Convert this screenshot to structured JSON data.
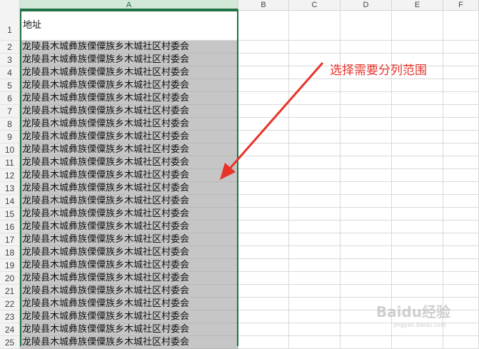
{
  "columns": [
    "A",
    "B",
    "C",
    "D",
    "E",
    "F"
  ],
  "rows": [
    "1",
    "2",
    "3",
    "4",
    "5",
    "6",
    "7",
    "8",
    "9",
    "10",
    "11",
    "12",
    "13",
    "14",
    "15",
    "16",
    "17",
    "18",
    "19",
    "20",
    "21",
    "22",
    "23",
    "24",
    "25"
  ],
  "header_cell": "地址",
  "address_value": "龙陵县木城彝族傈僳族乡木城社区村委会",
  "annotation_text": "选择需要分列范围",
  "annotation_color": "#e8332b",
  "selection_color": "#217346",
  "watermark": {
    "logo": "Baidu经验",
    "sub": "jingyan.baidu.com"
  }
}
